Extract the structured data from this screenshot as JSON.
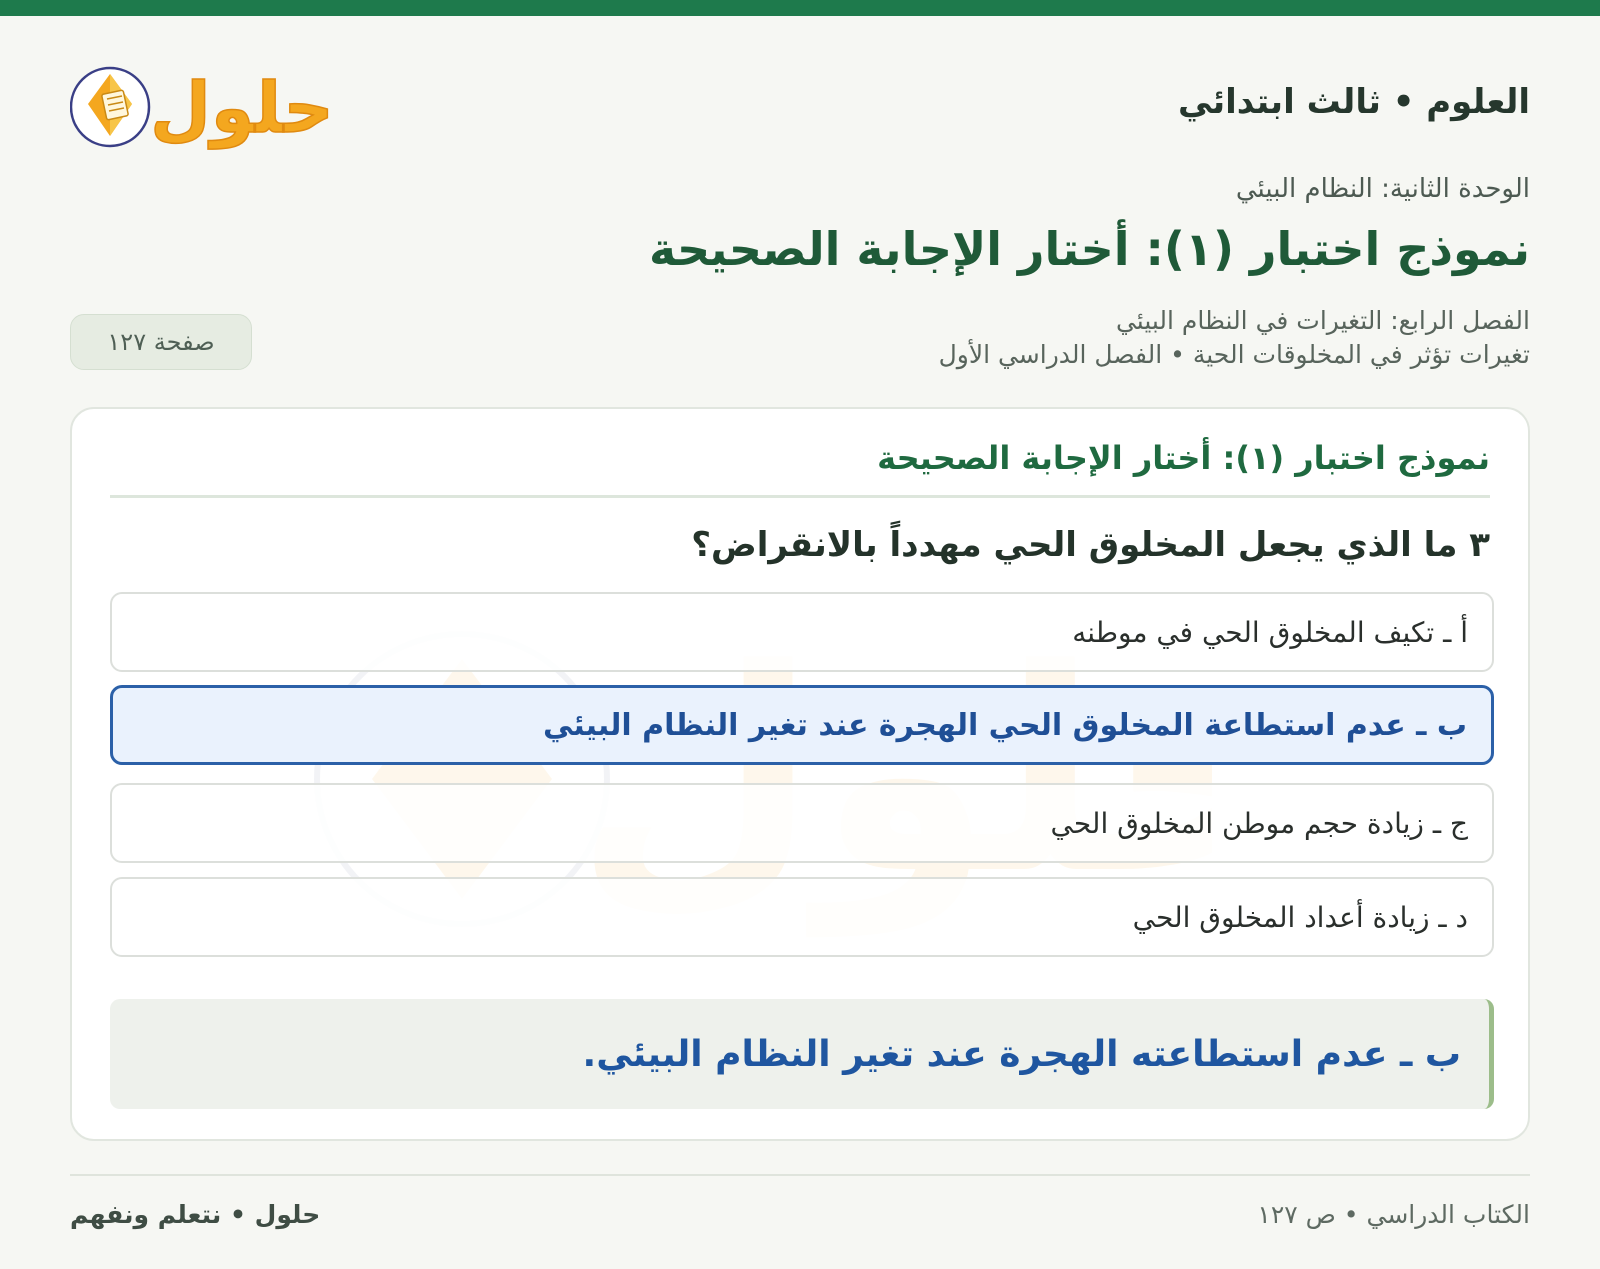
{
  "colors": {
    "top_bar": "#1e7a4c",
    "title_green": "#1f5a38",
    "selected_blue": "#2b60a8",
    "answer_blue": "#1f56a0",
    "logo_orange": "#f4a71f",
    "logo_ring": "#3a3f86"
  },
  "header": {
    "subject": "العلوم • ثالث ابتدائي",
    "logo_text": "حلول",
    "logo_icon": "book-icon"
  },
  "lesson": {
    "unit": "الوحدة الثانية: النظام البيئي",
    "title": "نموذج اختبار (١): أختار الإجابة الصحيحة",
    "chapter": "الفصل الرابع: التغيرات في النظام البيئي",
    "topic": "تغيرات تؤثر في المخلوقات الحية • الفصل الدراسي الأول",
    "page_badge": "صفحة ١٢٧"
  },
  "card": {
    "title": "نموذج اختبار (١): أختار الإجابة الصحيحة",
    "question": "٣ ما الذي يجعل المخلوق الحي مهدداً بالانقراض؟",
    "options": [
      {
        "label": "أ ـ تكيف المخلوق الحي في موطنه",
        "selected": false
      },
      {
        "label": "ب ـ عدم استطاعة المخلوق الحي الهجرة عند تغير النظام البيئي",
        "selected": true
      },
      {
        "label": "ج ـ زيادة حجم موطن المخلوق الحي",
        "selected": false
      },
      {
        "label": "د ـ زيادة أعداد المخلوق الحي",
        "selected": false
      }
    ],
    "answer": "ب ـ عدم استطاعته الهجرة عند تغير النظام البيئي."
  },
  "footer": {
    "left": "حلول • نتعلم ونفهم",
    "right": "الكتاب الدراسي • ص ١٢٧"
  }
}
